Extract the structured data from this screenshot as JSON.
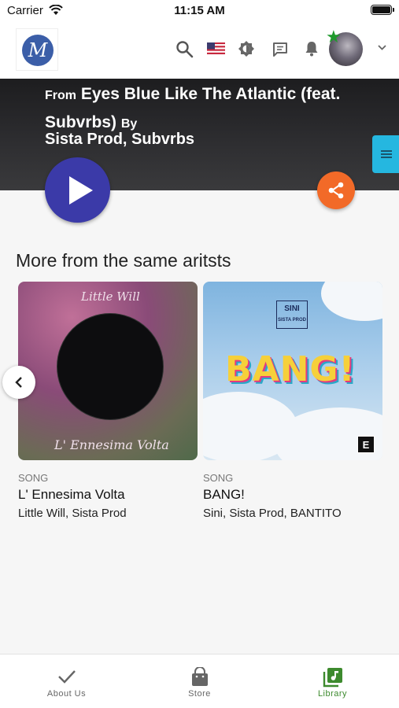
{
  "status_bar": {
    "carrier": "Carrier",
    "time": "11:15 AM"
  },
  "header": {
    "logo_letter": "M",
    "icons": [
      "search-icon",
      "flag-us-icon",
      "brightness-icon",
      "chat-icon",
      "bell-icon"
    ],
    "avatar_badge": "star-icon"
  },
  "hero": {
    "from_label": "From",
    "album": "Eyes Blue Like The Atlantic (feat. Subvrbs)",
    "by_label": "By",
    "artists": "Sista Prod, Subvrbs"
  },
  "section": {
    "title": "More from the same aritsts"
  },
  "cards": [
    {
      "type": "SONG",
      "title": "L' Ennesima Volta",
      "artists": "Little Will, Sista Prod",
      "art_top": "Little Will",
      "art_bottom": "L' Ennesima Volta",
      "explicit": false
    },
    {
      "type": "SONG",
      "title": "BANG!",
      "artists": "Sini, Sista Prod, BANTITO",
      "art_text": "BANG!",
      "art_label_top": "SINI",
      "art_label_bottom": "SISTA PROD",
      "explicit": true,
      "explicit_label": "E"
    }
  ],
  "bottom_nav": [
    {
      "label": "About Us",
      "icon": "check-icon",
      "active": false
    },
    {
      "label": "Store",
      "icon": "shopping-bag-icon",
      "active": false
    },
    {
      "label": "Library",
      "icon": "library-music-icon",
      "active": true
    }
  ],
  "colors": {
    "accent": "#3b3aa8",
    "share": "#f26a28",
    "active_nav": "#3d8a2e",
    "side_tab": "#25b7e0"
  }
}
